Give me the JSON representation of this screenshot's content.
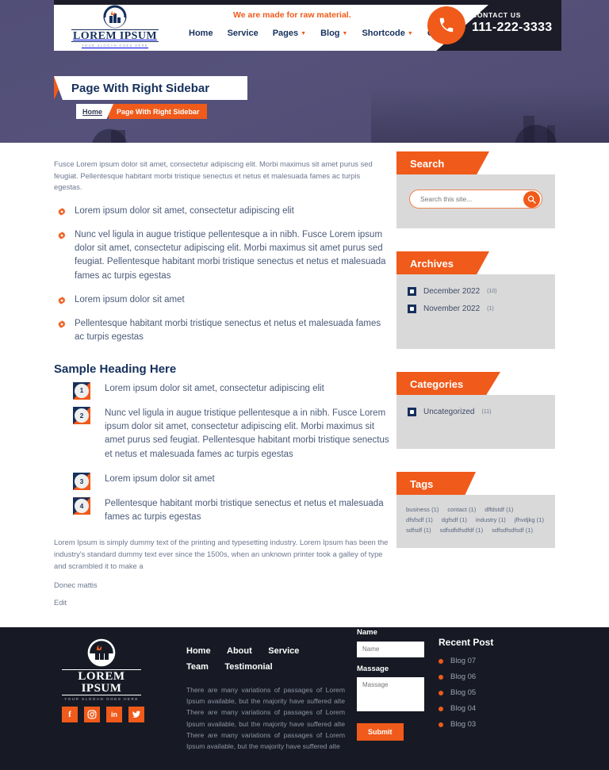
{
  "brand": {
    "name": "LOREM IPSUM",
    "slogan": "YOUR SLOGAN GOES HERE"
  },
  "header": {
    "tagline": "We are made for raw material.",
    "menu": [
      {
        "label": "Home",
        "caret": false
      },
      {
        "label": "Service",
        "caret": false
      },
      {
        "label": "Pages",
        "caret": true
      },
      {
        "label": "Blog",
        "caret": true
      },
      {
        "label": "Shortcode",
        "caret": true
      },
      {
        "label": "Contact",
        "caret": false
      }
    ],
    "contact_label": "CONTACT US",
    "contact_number": "111-222-3333",
    "phone_icon": "phone-icon"
  },
  "hero": {
    "page_title": "Page With Right Sidebar",
    "breadcrumb_home": "Home",
    "breadcrumb_current": "Page With Right Sidebar"
  },
  "main": {
    "intro": "Fusce Lorem ipsum dolor sit amet, consectetur adipiscing elit. Morbi maximus sit amet purus sed feugiat. Pellentesque habitant morbi tristique senectus et netus et malesuada fames ac turpis egestas.",
    "features": [
      "Lorem ipsum dolor sit amet, consectetur adipiscing elit",
      "Nunc vel ligula in augue tristique pellentesque a in nibh. Fusce Lorem ipsum dolor sit amet, consectetur adipiscing elit. Morbi maximus sit amet purus sed feugiat. Pellentesque habitant morbi tristique senectus et netus et malesuada fames ac turpis egestas",
      "Lorem ipsum dolor sit amet",
      "Pellentesque habitant morbi tristique senectus et netus et malesuada fames ac turpis egestas"
    ],
    "section_heading": "Sample Heading Here",
    "numbered": [
      {
        "n": "1",
        "text": "Lorem ipsum dolor sit amet, consectetur adipiscing elit"
      },
      {
        "n": "2",
        "text": "Nunc vel ligula in augue tristique pellentesque a in nibh. Fusce Lorem ipsum dolor sit amet, consectetur adipiscing elit. Morbi maximus sit amet purus sed feugiat. Pellentesque habitant morbi tristique senectus et netus et malesuada fames ac turpis egestas"
      },
      {
        "n": "3",
        "text": "Lorem ipsum dolor sit amet"
      },
      {
        "n": "4",
        "text": "Pellentesque habitant morbi tristique senectus et netus et malesuada fames ac turpis egestas"
      }
    ],
    "closing_paragraph": "Lorem Ipsum is simply dummy text of the printing and typesetting industry. Lorem Ipsum has been the industry's standard dummy text ever since the 1500s, when an unknown printer took a galley of type and scrambled it to make a",
    "donec": "Donec mattis",
    "edit": "Edit"
  },
  "sidebar": {
    "search": {
      "title": "Search",
      "placeholder": "Search this site...",
      "value": "",
      "button_icon": "search-icon"
    },
    "archives": {
      "title": "Archives",
      "items": [
        {
          "label": "December 2022",
          "count": "(10)"
        },
        {
          "label": "November 2022",
          "count": "(1)"
        }
      ]
    },
    "categories": {
      "title": "Categories",
      "items": [
        {
          "label": "Uncategorized",
          "count": "(11)"
        }
      ]
    },
    "tags": {
      "title": "Tags",
      "items": [
        "business (1)",
        "contact (1)",
        "dffdstdf (1)",
        "dfsfsdf (1)",
        "dgfsdf (1)",
        "industry (1)",
        "jfhvdjkg (1)",
        "sdfsdf (1)",
        "sdfsdfdfsdfdf (1)",
        "sdfsdfsdfsdf (1)"
      ]
    }
  },
  "footer": {
    "socials": [
      {
        "name": "facebook-icon",
        "glyph": "f"
      },
      {
        "name": "instagram-icon",
        "glyph": "▣"
      },
      {
        "name": "linkedin-icon",
        "glyph": "in"
      },
      {
        "name": "twitter-icon",
        "glyph": "✈"
      }
    ],
    "nav": [
      "Home",
      "About",
      "Service",
      "Team",
      "Testimonial"
    ],
    "about_text": "There are many variations of passages of Lorem Ipsum available, but the majority have suffered alte There are many variations of passages of Lorem Ipsum available, but the majority have suffered alte There are many variations of passages of Lorem Ipsum available, but the majority have suffered alte",
    "form": {
      "name_label": "Name",
      "name_placeholder": "Name",
      "name_value": "",
      "message_label": "Massage",
      "message_placeholder": "Massage",
      "message_value": "",
      "submit_label": "Submit"
    },
    "recent": {
      "title": "Recent Post",
      "items": [
        "Blog 07",
        "Blog 06",
        "Blog 05",
        "Blog 04",
        "Blog 03"
      ]
    }
  },
  "colors": {
    "accent": "#f05a1a",
    "navy": "#16305c",
    "dark": "#171a24",
    "hero": "#514e77"
  }
}
